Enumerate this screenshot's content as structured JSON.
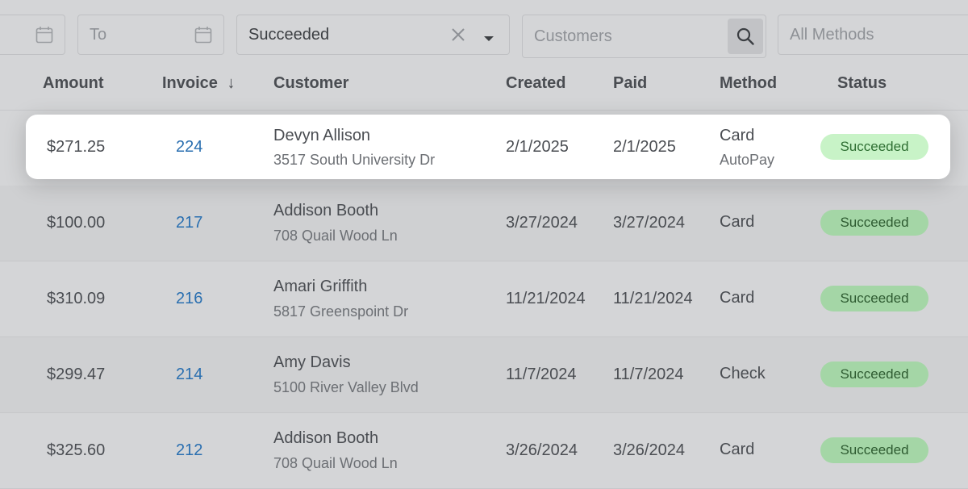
{
  "filters": {
    "to_placeholder": "To",
    "status_value": "Succeeded",
    "customers_placeholder": "Customers",
    "methods_value": "All Methods"
  },
  "columns": {
    "amount": "Amount",
    "invoice": "Invoice",
    "invoice_sort_icon": "↓",
    "customer": "Customer",
    "created": "Created",
    "paid": "Paid",
    "method": "Method",
    "status": "Status"
  },
  "rows": [
    {
      "amount": "$271.25",
      "invoice": "224",
      "customer": "Devyn Allison",
      "address": "3517 South University Dr",
      "created": "2/1/2025",
      "paid": "2/1/2025",
      "method": "Card",
      "method_sub": "AutoPay",
      "status": "Succeeded"
    },
    {
      "amount": "$100.00",
      "invoice": "217",
      "customer": "Addison Booth",
      "address": "708 Quail Wood Ln",
      "created": "3/27/2024",
      "paid": "3/27/2024",
      "method": "Card",
      "method_sub": "",
      "status": "Succeeded"
    },
    {
      "amount": "$310.09",
      "invoice": "216",
      "customer": "Amari Griffith",
      "address": "5817 Greenspoint Dr",
      "created": "11/21/2024",
      "paid": "11/21/2024",
      "method": "Card",
      "method_sub": "",
      "status": "Succeeded"
    },
    {
      "amount": "$299.47",
      "invoice": "214",
      "customer": "Amy Davis",
      "address": "5100 River Valley Blvd",
      "created": "11/7/2024",
      "paid": "11/7/2024",
      "method": "Check",
      "method_sub": "",
      "status": "Succeeded"
    },
    {
      "amount": "$325.60",
      "invoice": "212",
      "customer": "Addison Booth",
      "address": "708 Quail Wood Ln",
      "created": "3/26/2024",
      "paid": "3/26/2024",
      "method": "Card",
      "method_sub": "",
      "status": "Succeeded"
    }
  ],
  "colors": {
    "page_bg": "#d4d5d7",
    "invoice_link": "#2a6fb0",
    "badge_bg": "#a4d6a6",
    "badge_bg_highlight": "#c8f3c7",
    "badge_text": "#2e5b31"
  }
}
